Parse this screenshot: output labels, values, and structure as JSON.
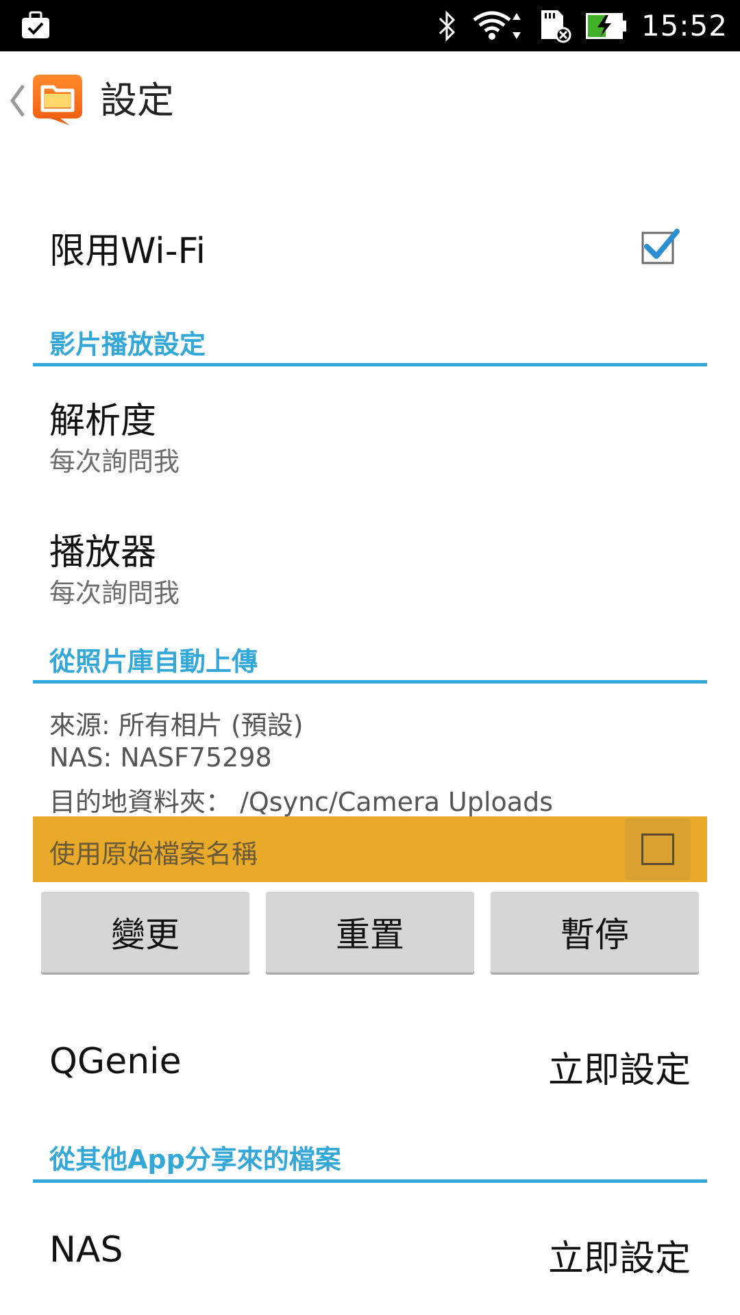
{
  "status_bar": {
    "time": "15:52",
    "icons": [
      "briefcase-check-icon",
      "bluetooth-icon",
      "wifi-icon",
      "sd-card-icon",
      "battery-charging-icon"
    ]
  },
  "app_bar": {
    "title": "設定"
  },
  "wifi_only": {
    "label": "限用Wi-Fi",
    "checked": true
  },
  "sections": {
    "video": "影片播放設定",
    "auto_upload": "從照片庫自動上傳",
    "shared": "從其他App分享來的檔案"
  },
  "resolution": {
    "title": "解析度",
    "value": "每次詢問我"
  },
  "player": {
    "title": "播放器",
    "value": "每次詢問我"
  },
  "upload_info": {
    "source": "來源: 所有相片 (預設)",
    "nas": "NAS: NASF75298",
    "dest": "目的地資料夾： /Qsync/Camera Uploads"
  },
  "original_name": {
    "label": "使用原始檔案名稱",
    "checked": false
  },
  "buttons": {
    "change": "變更",
    "reset": "重置",
    "pause": "暫停"
  },
  "qgenie": {
    "label": "QGenie",
    "action": "立即設定"
  },
  "nas_row": {
    "label": "NAS",
    "action": "立即設定"
  },
  "colors": {
    "accent": "#33a8d8",
    "highlight": "#e8aa28"
  }
}
